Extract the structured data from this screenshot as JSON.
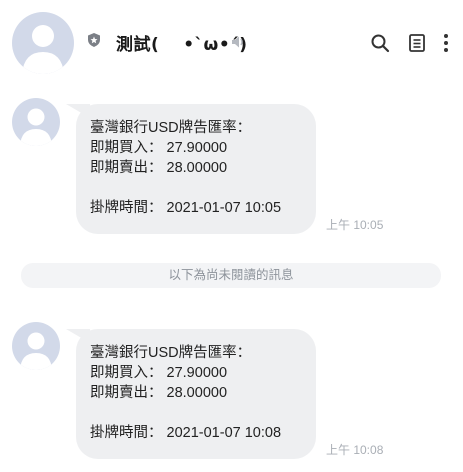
{
  "header": {
    "title": "測試( 　•`ω•´)",
    "icons": [
      "avatar",
      "shield-badge-icon",
      "mute-icon",
      "search-icon",
      "notes-icon",
      "more-icon"
    ]
  },
  "messages": [
    {
      "text": "臺灣銀行USD牌告匯率：\n即期買入： 27.90000\n即期賣出： 28.00000\n\n掛牌時間： 2021-01-07 10:05",
      "time": "上午 10:05"
    },
    {
      "text": "臺灣銀行USD牌告匯率：\n即期買入： 27.90000\n即期賣出： 28.00000\n\n掛牌時間： 2021-01-07 10:08",
      "time": "上午 10:08"
    }
  ],
  "divider": {
    "label": "以下為尚未閱讀的訊息"
  },
  "colors": {
    "bubble": "#eeeff1",
    "avatar": "#d2d9e9",
    "time": "#a9aeb5"
  }
}
